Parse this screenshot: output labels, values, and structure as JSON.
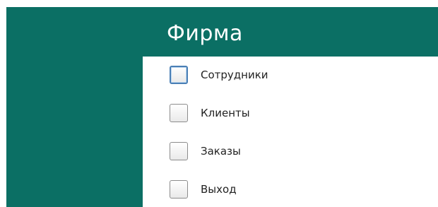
{
  "window": {
    "title": "Фирма",
    "accent_color": "#0b6f64"
  },
  "menu": {
    "items": [
      {
        "label": "Сотрудники",
        "focused": true
      },
      {
        "label": "Клиенты",
        "focused": false
      },
      {
        "label": "Заказы",
        "focused": false
      },
      {
        "label": "Выход",
        "focused": false
      }
    ]
  }
}
